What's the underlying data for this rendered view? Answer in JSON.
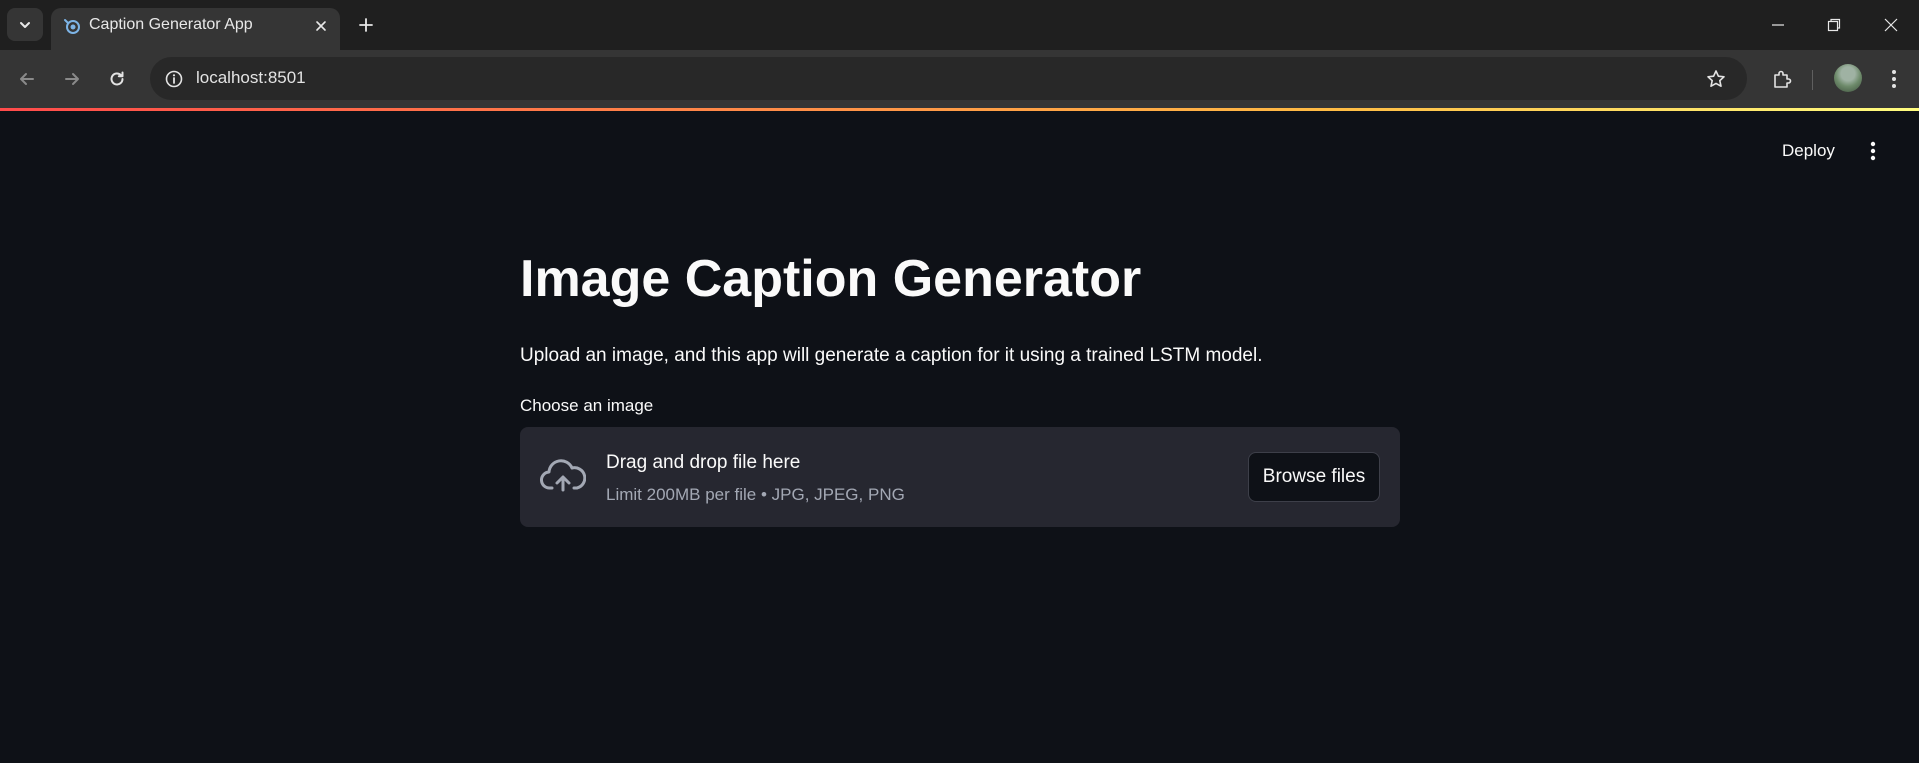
{
  "browser": {
    "tab_title": "Caption Generator App",
    "url": "localhost:8501",
    "icons": {
      "tab_search": "chevron-down-icon",
      "favicon": "streamlit-favicon",
      "tab_close": "close-icon",
      "new_tab": "plus-icon",
      "back": "arrow-left-icon",
      "forward": "arrow-right-icon",
      "reload": "reload-icon",
      "site_info": "info-icon",
      "bookmark": "star-icon",
      "extensions": "puzzle-icon",
      "menu": "kebab-menu-icon"
    }
  },
  "app": {
    "header": {
      "deploy_label": "Deploy"
    },
    "title": "Image Caption Generator",
    "description": "Upload an image, and this app will generate a caption for it using a trained LSTM model.",
    "uploader": {
      "label": "Choose an image",
      "drop_text": "Drag and drop file here",
      "limit_text": "Limit 200MB per file • JPG, JPEG, PNG",
      "browse_label": "Browse files"
    }
  },
  "colors": {
    "background": "#0e1117",
    "dropzone": "#262730",
    "text": "#fafafa",
    "muted_text": "#a3a8b4",
    "accent_gradient": [
      "#ff4b4b",
      "#ffbd45",
      "#fffd80"
    ]
  }
}
